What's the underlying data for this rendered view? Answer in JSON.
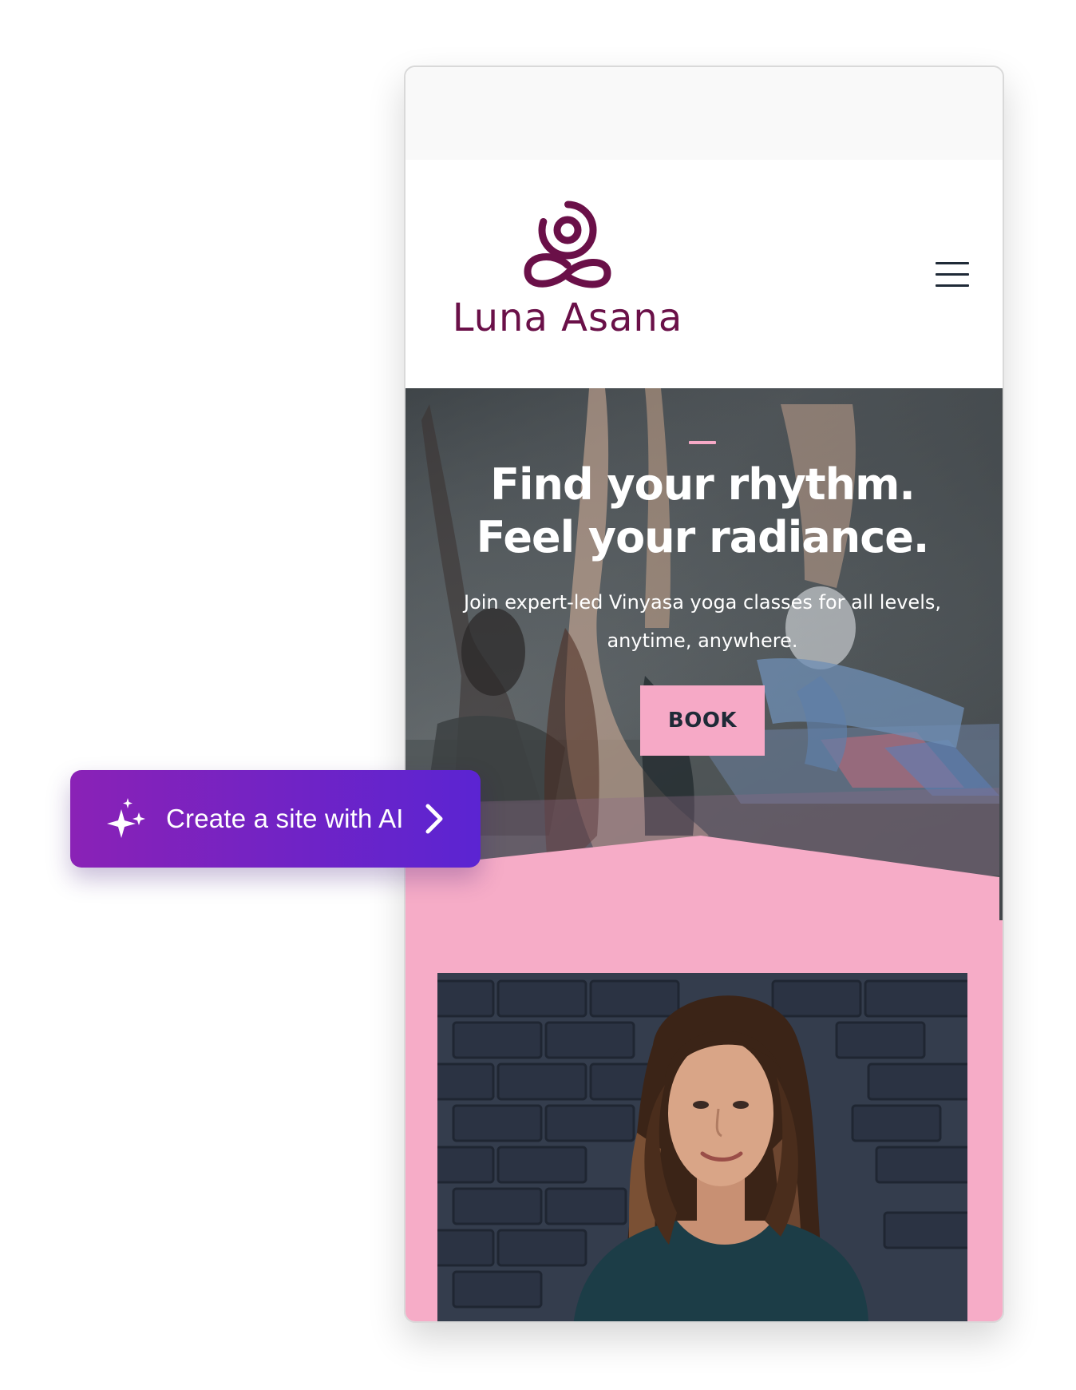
{
  "brand": {
    "name": "Luna Asana",
    "color": "#6a1048"
  },
  "hero": {
    "title": "Find your rhythm. Feel your radiance.",
    "subtitle": "Join expert-led Vinyasa yoga classes for all levels, anytime, anywhere.",
    "book_label": "BOOK",
    "accent_color": "#f6a9c6"
  },
  "header": {
    "menu_icon": "hamburger-menu-icon"
  },
  "section": {
    "background_color": "#f6acc7"
  },
  "ai_cta": {
    "label": "Create a site with AI",
    "icon": "sparkle-icon",
    "arrow_icon": "chevron-right-icon",
    "gradient_start": "#8a22b6",
    "gradient_end": "#5b24d2"
  }
}
